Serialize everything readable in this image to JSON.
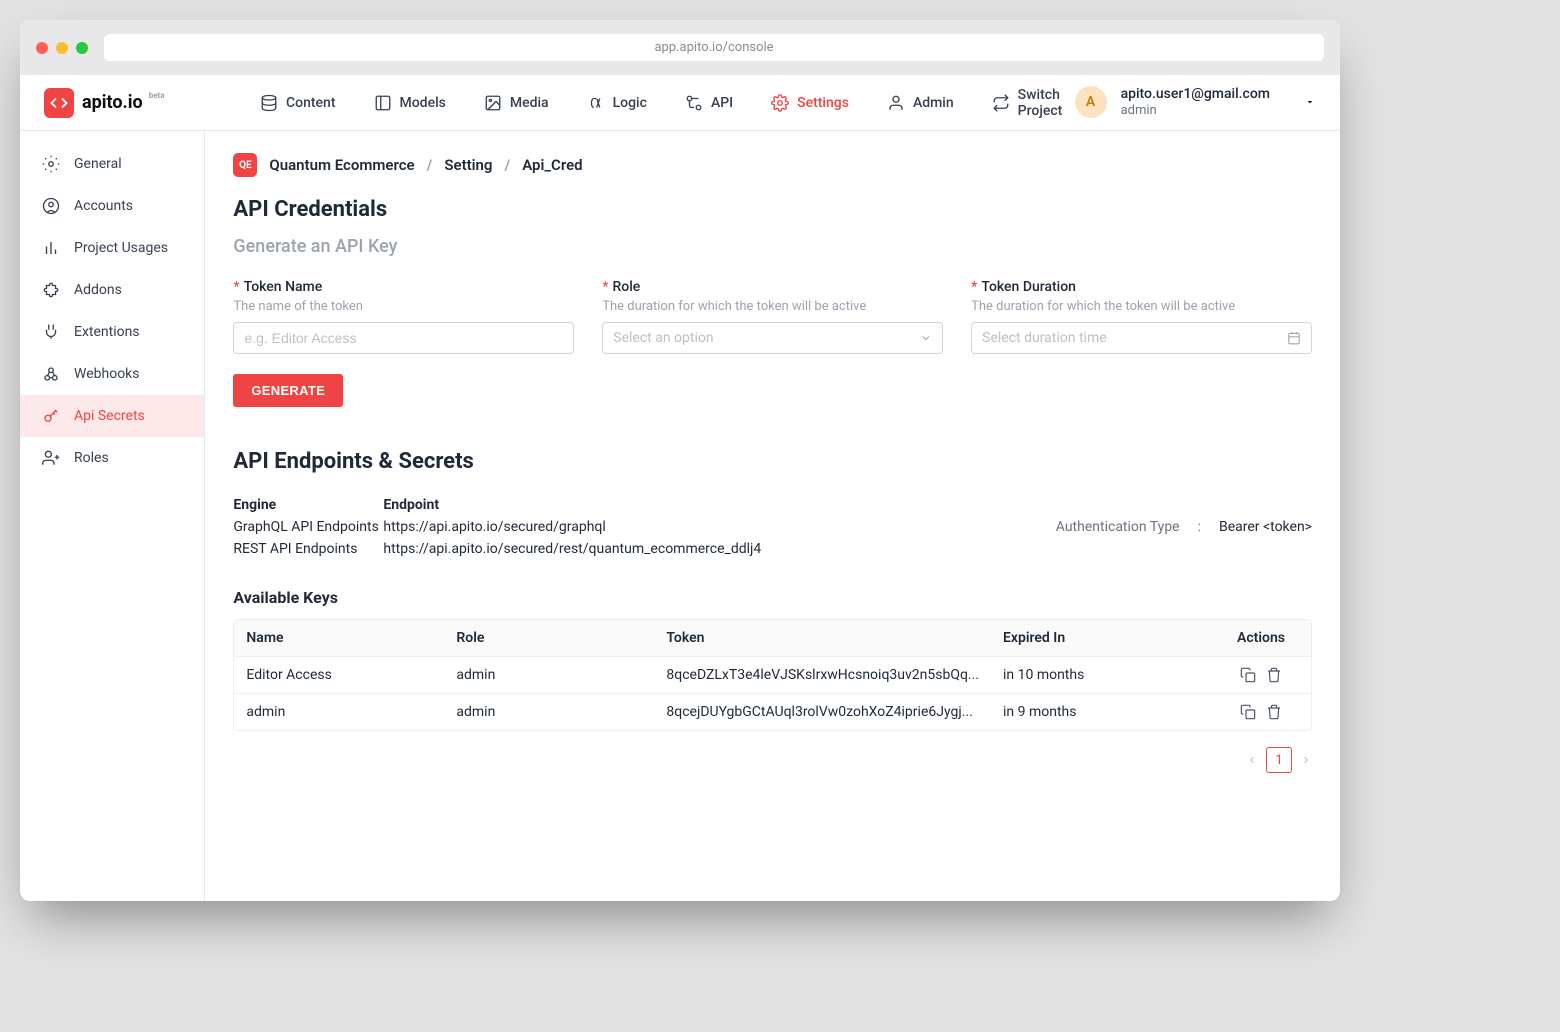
{
  "browser": {
    "url": "app.apito.io/console"
  },
  "logo": {
    "text": "apito.io",
    "tag": "beta"
  },
  "topnav": [
    {
      "label": "Content"
    },
    {
      "label": "Models"
    },
    {
      "label": "Media"
    },
    {
      "label": "Logic"
    },
    {
      "label": "API"
    },
    {
      "label": "Settings",
      "active": true
    },
    {
      "label": "Admin"
    },
    {
      "label": "Switch Project"
    }
  ],
  "user": {
    "initial": "A",
    "email": "apito.user1@gmail.com",
    "role": "admin"
  },
  "sidebar": [
    {
      "label": "General"
    },
    {
      "label": "Accounts"
    },
    {
      "label": "Project Usages"
    },
    {
      "label": "Addons"
    },
    {
      "label": "Extentions"
    },
    {
      "label": "Webhooks"
    },
    {
      "label": "Api Secrets",
      "active": true
    },
    {
      "label": "Roles"
    }
  ],
  "breadcrumb": {
    "badge": "QE",
    "parts": [
      "Quantum Ecommerce",
      "Setting",
      "Api_Cred"
    ]
  },
  "page": {
    "title": "API Credentials",
    "subtitle": "Generate an API Key"
  },
  "form": {
    "token_name": {
      "label": "Token Name",
      "hint": "The name of the token",
      "placeholder": "e.g. Editor Access"
    },
    "role": {
      "label": "Role",
      "hint": "The duration for which the token will be active",
      "placeholder": "Select an option"
    },
    "duration": {
      "label": "Token Duration",
      "hint": "The duration for which the token will be active",
      "placeholder": "Select duration time"
    },
    "generate_label": "GENERATE"
  },
  "endpoints": {
    "title": "API Endpoints & Secrets",
    "headers": {
      "engine": "Engine",
      "endpoint": "Endpoint"
    },
    "rows": [
      {
        "engine": "GraphQL API Endpoints",
        "endpoint": "https://api.apito.io/secured/graphql"
      },
      {
        "engine": "REST API Endpoints",
        "endpoint": "https://api.apito.io/secured/rest/quantum_ecommerce_ddlj4"
      }
    ],
    "auth_label": "Authentication Type",
    "auth_value": "Bearer <token>"
  },
  "keys": {
    "title": "Available Keys",
    "headers": {
      "name": "Name",
      "role": "Role",
      "token": "Token",
      "expired": "Expired In",
      "actions": "Actions"
    },
    "rows": [
      {
        "name": "Editor Access",
        "role": "admin",
        "token": "8qceDZLxT3e4leVJSKslrxwHcsnoiq3uv2n5sbQq...",
        "expired": "in 10 months"
      },
      {
        "name": "admin",
        "role": "admin",
        "token": "8qcejDUYgbGCtAUql3rolVw0zohXoZ4iprie6Jygj...",
        "expired": "in 9 months"
      }
    ]
  },
  "pagination": {
    "current": "1"
  }
}
